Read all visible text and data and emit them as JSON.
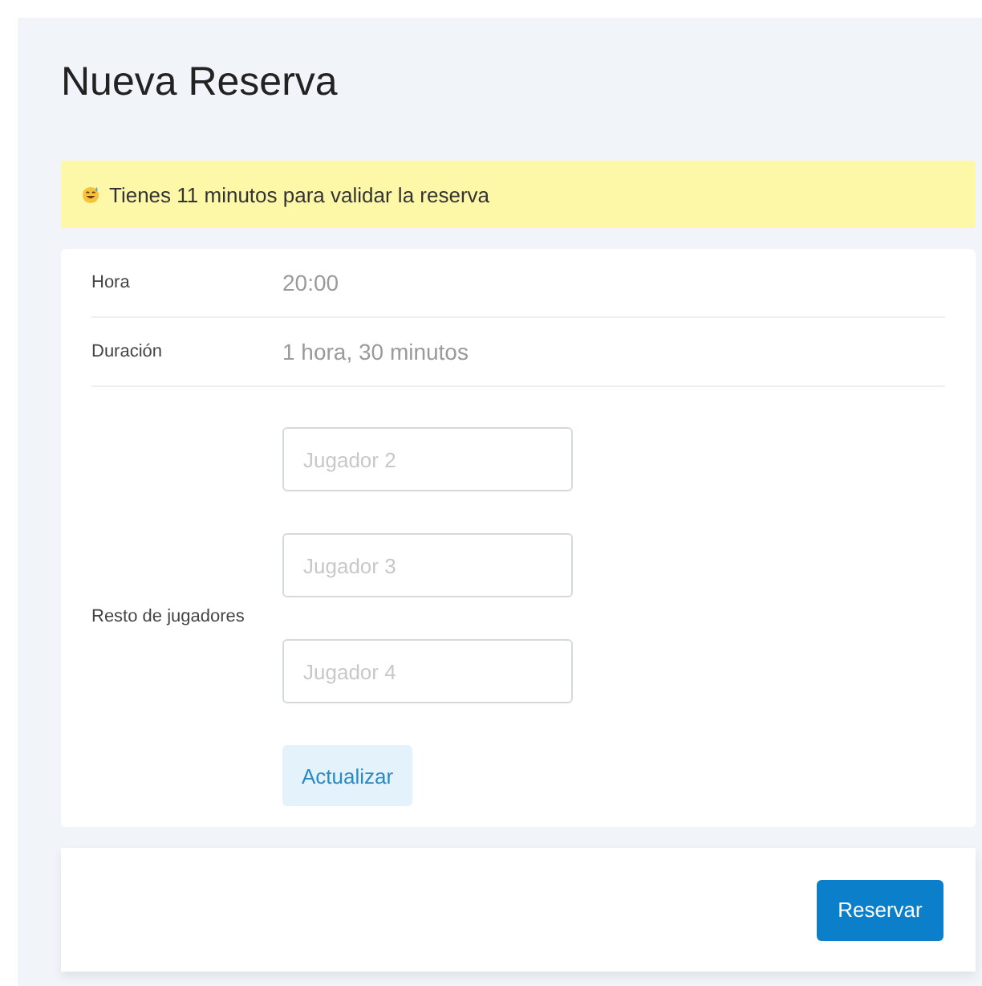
{
  "title": "Nueva Reserva",
  "notice": {
    "text": "Tienes 11 minutos para validar la reserva"
  },
  "details": [
    {
      "label": "Hora",
      "value": "20:00"
    },
    {
      "label": "Duración",
      "value": "1 hora, 30 minutos"
    }
  ],
  "players": {
    "label": "Resto de jugadores",
    "fields": [
      {
        "placeholder": "Jugador 2"
      },
      {
        "placeholder": "Jugador 3"
      },
      {
        "placeholder": "Jugador 4"
      }
    ],
    "update_button": "Actualizar"
  },
  "submit_button": "Reservar"
}
